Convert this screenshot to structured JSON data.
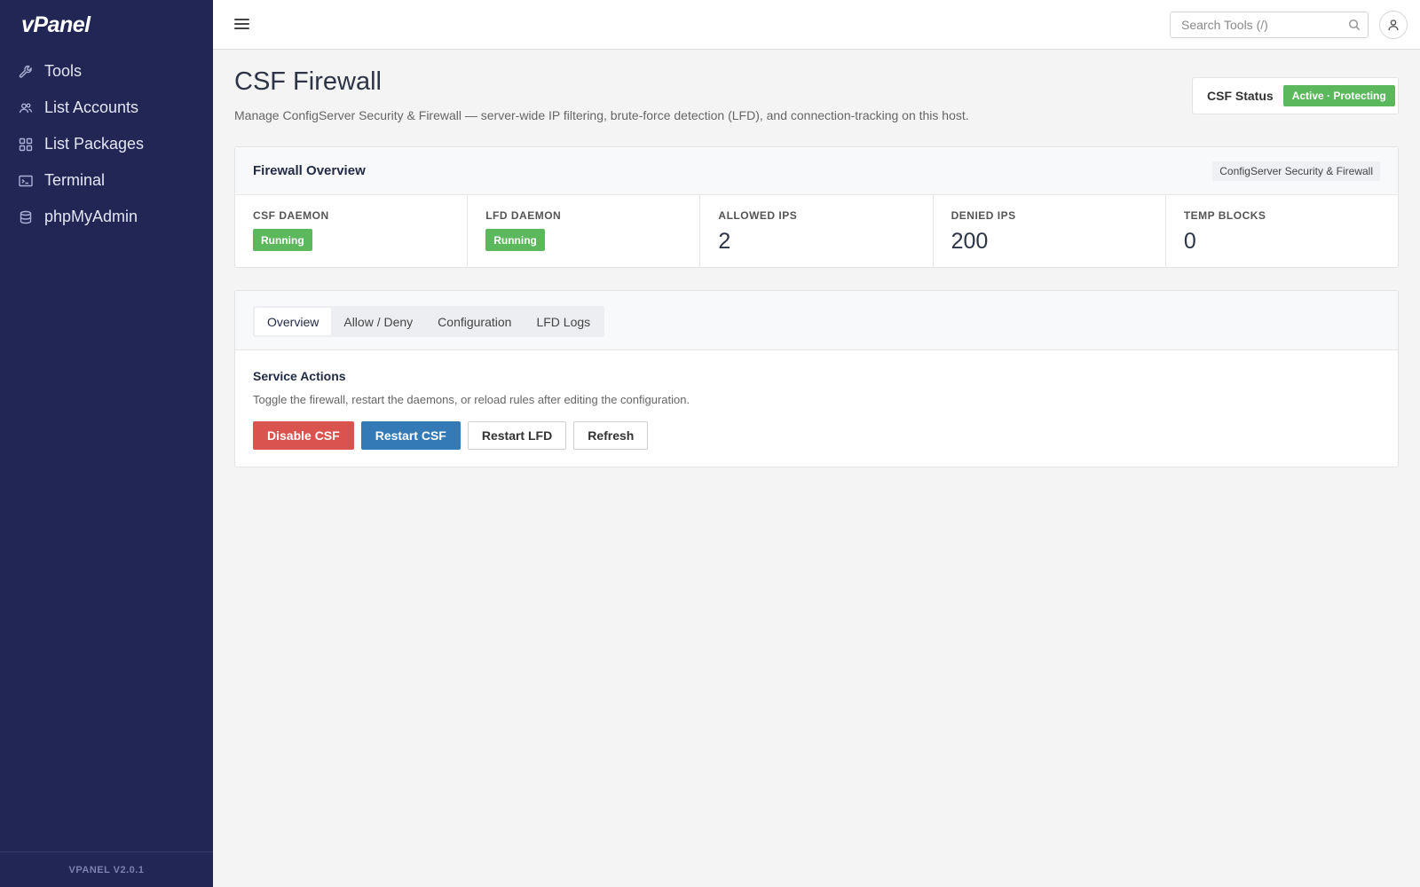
{
  "brand": "vPanel",
  "sidebar": {
    "items": [
      {
        "label": "Tools",
        "icon": "wrench-icon"
      },
      {
        "label": "List Accounts",
        "icon": "users-icon"
      },
      {
        "label": "List Packages",
        "icon": "grid-icon"
      },
      {
        "label": "Terminal",
        "icon": "terminal-icon"
      },
      {
        "label": "phpMyAdmin",
        "icon": "database-icon"
      }
    ],
    "version": "VPANEL V2.0.1"
  },
  "topbar": {
    "search_placeholder": "Search Tools (/)"
  },
  "page": {
    "title": "CSF Firewall",
    "description": "Manage ConfigServer Security & Firewall — server-wide IP filtering, brute-force detection (LFD), and connection-tracking on this host.",
    "status_label": "CSF Status",
    "status_value": "Active · Protecting",
    "status_color": "#5cb85c"
  },
  "overview": {
    "title": "Firewall Overview",
    "tag": "ConfigServer Security & Firewall",
    "stats": [
      {
        "label": "CSF DAEMON",
        "value": "Running"
      },
      {
        "label": "LFD DAEMON",
        "value": "Running"
      },
      {
        "label": "ALLOWED IPS",
        "value": "2"
      },
      {
        "label": "DENIED IPS",
        "value": "200"
      },
      {
        "label": "TEMP BLOCKS",
        "value": "0"
      }
    ]
  },
  "tabs": {
    "items": [
      "Overview",
      "Allow / Deny",
      "Configuration",
      "LFD Logs"
    ],
    "active": "Overview"
  },
  "service_actions": {
    "title": "Service Actions",
    "description": "Toggle the firewall, restart the daemons, or reload rules after editing the configuration.",
    "buttons": {
      "disable": "Disable CSF",
      "restart_csf": "Restart CSF",
      "restart_lfd": "Restart LFD",
      "refresh": "Refresh"
    }
  },
  "colors": {
    "sidebar_bg": "#212654",
    "danger": "#d9534f",
    "primary": "#337ab7",
    "success": "#5cb85c"
  }
}
